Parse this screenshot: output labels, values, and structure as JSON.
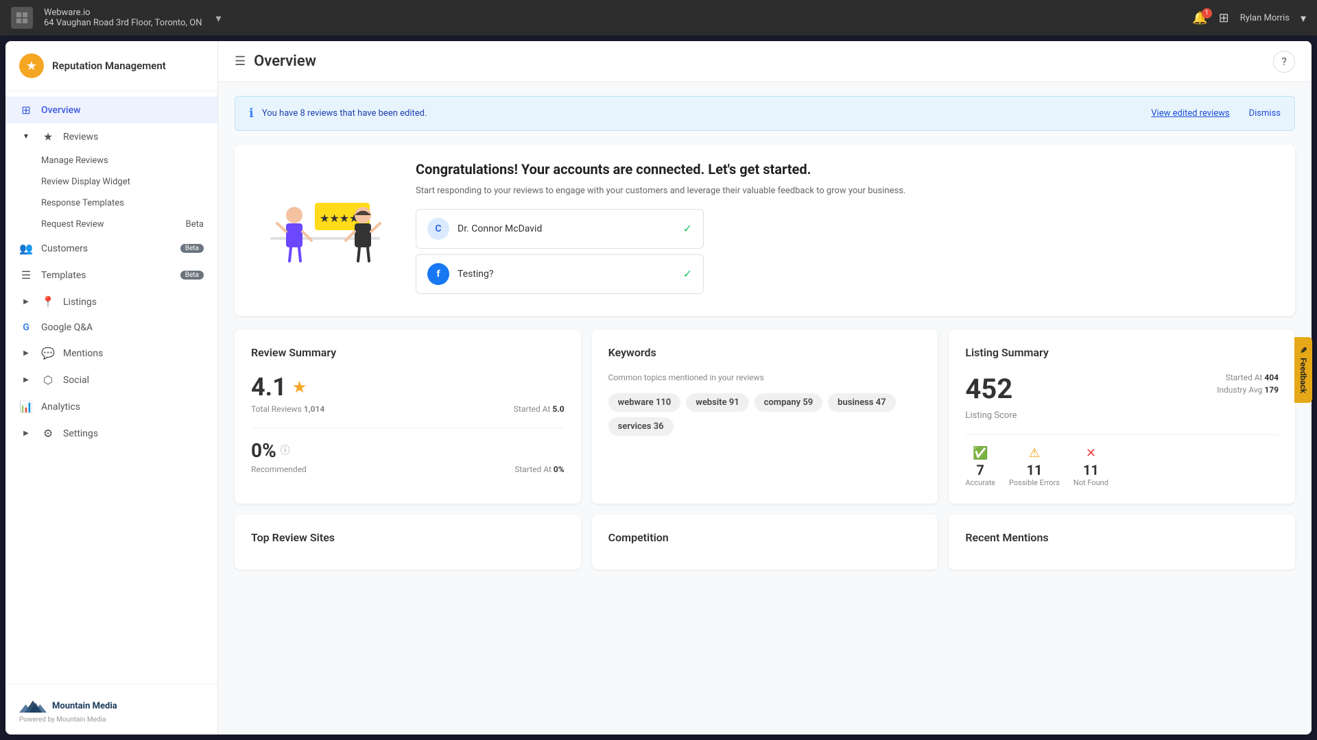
{
  "browser": {
    "company": "Webware.io",
    "address": "64 Vaughan Road 3rd Floor, Toronto, ON",
    "notifications": "1",
    "user": "Rylan Morris"
  },
  "sidebar": {
    "app_name": "Reputation Management",
    "nav_items": [
      {
        "id": "overview",
        "label": "Overview",
        "icon": "⊞",
        "active": true
      },
      {
        "id": "reviews",
        "label": "Reviews",
        "icon": "★",
        "expanded": true
      },
      {
        "id": "manage-reviews",
        "label": "Manage Reviews",
        "sub": true
      },
      {
        "id": "review-widget",
        "label": "Review Display Widget",
        "sub": true
      },
      {
        "id": "response-templates",
        "label": "Response Templates",
        "sub": true
      },
      {
        "id": "request-review",
        "label": "Request Review",
        "badge": "Beta",
        "sub": true
      },
      {
        "id": "customers",
        "label": "Customers",
        "icon": "👥",
        "badge": "Beta"
      },
      {
        "id": "templates",
        "label": "Templates",
        "icon": "☰",
        "badge": "Beta"
      },
      {
        "id": "listings",
        "label": "Listings",
        "icon": "📍",
        "arrow": true
      },
      {
        "id": "google-qa",
        "label": "Google Q&A",
        "icon": "G"
      },
      {
        "id": "mentions",
        "label": "Mentions",
        "icon": "💬",
        "arrow": true
      },
      {
        "id": "social",
        "label": "Social",
        "icon": "⬡",
        "arrow": true
      },
      {
        "id": "analytics",
        "label": "Analytics",
        "icon": "📊"
      },
      {
        "id": "settings",
        "label": "Settings",
        "icon": "⚙",
        "arrow": true
      }
    ],
    "footer": {
      "powered_by": "Powered by",
      "company": "Mountain Media"
    }
  },
  "header": {
    "title": "Overview"
  },
  "alert": {
    "message": "You have 8 reviews that have been edited.",
    "link_text": "View edited reviews",
    "dismiss_text": "Dismiss"
  },
  "congrats": {
    "title": "Congratulations! Your accounts are connected. Let's get started.",
    "description": "Start responding to your reviews to engage with your customers and leverage their valuable feedback to grow your business.",
    "accounts": [
      {
        "id": "connor",
        "name": "Dr. Connor McDavid",
        "type": "avatar",
        "initials": "C"
      },
      {
        "id": "testing",
        "name": "Testing?",
        "type": "facebook"
      }
    ]
  },
  "review_summary": {
    "title": "Review Summary",
    "score": "4.1",
    "total_reviews_label": "Total Reviews",
    "total_reviews_value": "1,014",
    "started_at_label": "Started At",
    "started_at_value": "5.0",
    "recommend_pct": "0%",
    "recommend_label": "Recommended",
    "recommend_started_label": "Started At",
    "recommend_started_value": "0%"
  },
  "keywords": {
    "title": "Keywords",
    "description": "Common topics mentioned in your reviews",
    "tags": [
      {
        "word": "webware",
        "count": "110"
      },
      {
        "word": "website",
        "count": "91"
      },
      {
        "word": "company",
        "count": "59"
      },
      {
        "word": "business",
        "count": "47"
      },
      {
        "word": "services",
        "count": "36"
      }
    ]
  },
  "listing_summary": {
    "title": "Listing Summary",
    "score": "452",
    "score_label": "Listing Score",
    "started_at_label": "Started At",
    "started_at_value": "404",
    "industry_avg_label": "Industry Avg",
    "industry_avg_value": "179",
    "stats": [
      {
        "id": "accurate",
        "num": "7",
        "label": "Accurate",
        "type": "accurate"
      },
      {
        "id": "errors",
        "num": "11",
        "label": "Possible Errors",
        "type": "errors"
      },
      {
        "id": "notfound",
        "num": "11",
        "label": "Not Found",
        "type": "notfound"
      }
    ]
  },
  "bottom_cards": [
    {
      "id": "top-review-sites",
      "title": "Top Review Sites"
    },
    {
      "id": "competition",
      "title": "Competition"
    },
    {
      "id": "recent-mentions",
      "title": "Recent Mentions"
    }
  ],
  "feedback_tab": "Feedback"
}
